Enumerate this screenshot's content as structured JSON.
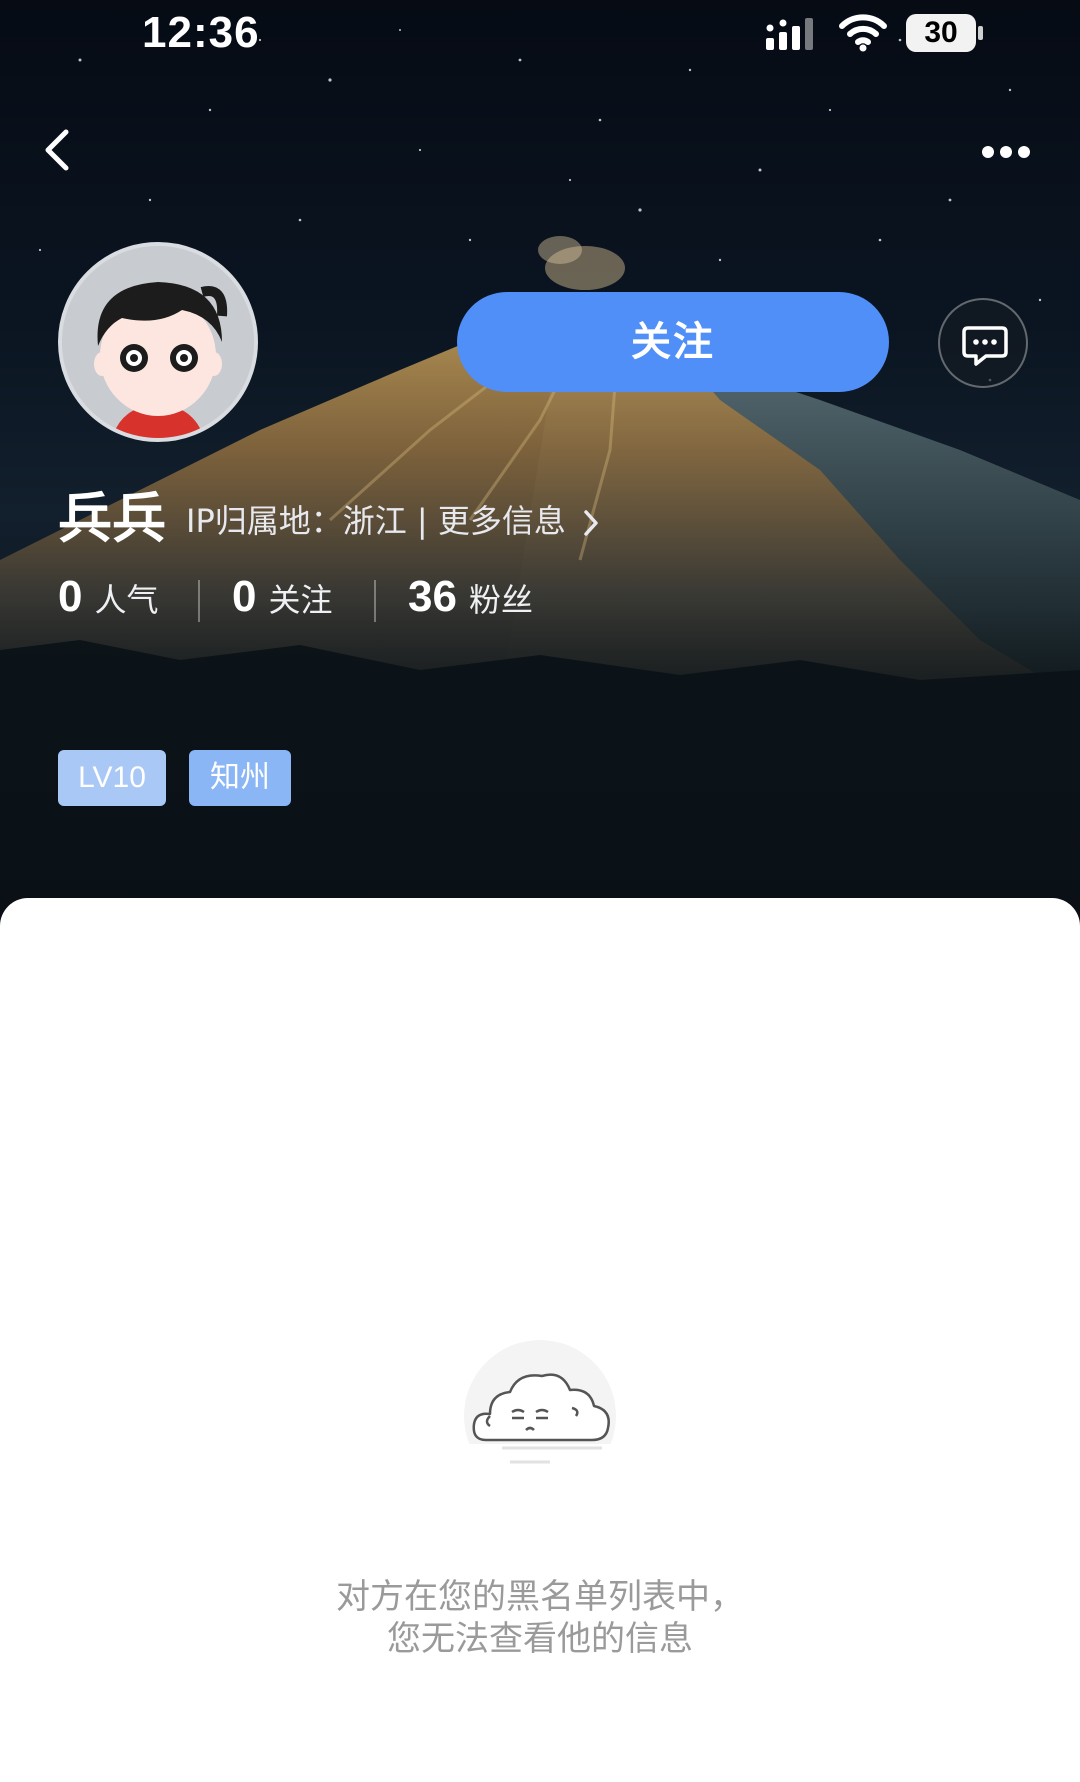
{
  "status_bar": {
    "time": "12:36",
    "battery": "30",
    "icons": [
      "signal-icon",
      "wifi-icon",
      "battery-icon"
    ]
  },
  "nav": {
    "back_icon": "chevron-left-icon",
    "more_icon": "more-dots-icon"
  },
  "profile": {
    "username": "兵兵",
    "ip_label": "IP归属地：浙江 | 更多信息",
    "follow_label": "关注",
    "message_icon": "chat-bubble-icon",
    "stats": [
      {
        "value": "0",
        "label": "人气"
      },
      {
        "value": "0",
        "label": "关注"
      },
      {
        "value": "36",
        "label": "粉丝"
      }
    ],
    "tags": {
      "level": "LV10",
      "title": "知州"
    }
  },
  "content": {
    "blocked_line1": "对方在您的黑名单列表中，",
    "blocked_line2": "您无法查看他的信息"
  },
  "colors": {
    "accent": "#4f8ff7",
    "tag": "#a9c8f5",
    "muted_text": "#9a9a9a"
  }
}
